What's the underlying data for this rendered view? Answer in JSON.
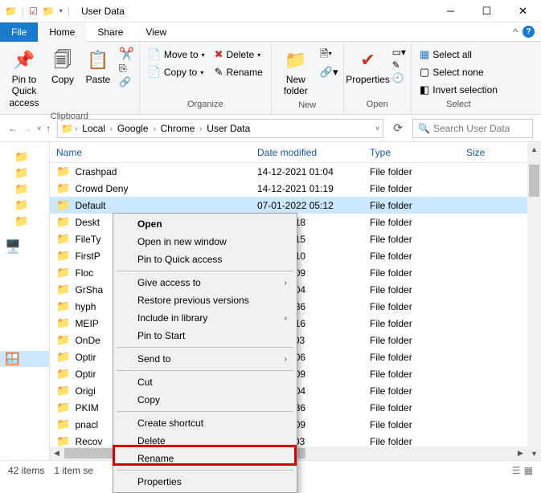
{
  "window": {
    "title": "User Data"
  },
  "tabs": {
    "file": "File",
    "home": "Home",
    "share": "Share",
    "view": "View"
  },
  "ribbon": {
    "clipboard": {
      "label": "Clipboard",
      "pin": "Pin to Quick access",
      "copy": "Copy",
      "paste": "Paste"
    },
    "organize": {
      "label": "Organize",
      "moveto": "Move to",
      "copyto": "Copy to",
      "delete": "Delete",
      "rename": "Rename"
    },
    "new": {
      "label": "New",
      "newfolder": "New folder"
    },
    "open": {
      "label": "Open",
      "properties": "Properties"
    },
    "select": {
      "label": "Select",
      "all": "Select all",
      "none": "Select none",
      "invert": "Invert selection"
    }
  },
  "breadcrumb": [
    "Local",
    "Google",
    "Chrome",
    "User Data"
  ],
  "search": {
    "placeholder": "Search User Data"
  },
  "columns": {
    "name": "Name",
    "date": "Date modified",
    "type": "Type",
    "size": "Size"
  },
  "files": [
    {
      "name": "Crashpad",
      "date": "14-12-2021 01:04",
      "type": "File folder"
    },
    {
      "name": "Crowd Deny",
      "date": "14-12-2021 01:19",
      "type": "File folder"
    },
    {
      "name": "Default",
      "date": "07-01-2022 05:12",
      "type": "File folder",
      "selected": true
    },
    {
      "name": "Deskt",
      "date": "2021 01:18",
      "type": "File folder"
    },
    {
      "name": "FileTy",
      "date": "2021 01:15",
      "type": "File folder"
    },
    {
      "name": "FirstP",
      "date": "2021 01:10",
      "type": "File folder"
    },
    {
      "name": "Floc",
      "date": "2021 01:09",
      "type": "File folder"
    },
    {
      "name": "GrSha",
      "date": "2021 01:04",
      "type": "File folder"
    },
    {
      "name": "hyph",
      "date": "2022 03:36",
      "type": "File folder"
    },
    {
      "name": "MEIP",
      "date": "2021 01:16",
      "type": "File folder"
    },
    {
      "name": "OnDe",
      "date": "2022 11:03",
      "type": "File folder"
    },
    {
      "name": "Optir",
      "date": "2021 01:06",
      "type": "File folder"
    },
    {
      "name": "Optir",
      "date": "2021 01:09",
      "type": "File folder"
    },
    {
      "name": "Origi",
      "date": "2021 01:04",
      "type": "File folder"
    },
    {
      "name": "PKIM",
      "date": "2022 10:36",
      "type": "File folder"
    },
    {
      "name": "pnacl",
      "date": "2021 01:09",
      "type": "File folder"
    },
    {
      "name": "Recov",
      "date": "2022 11:03",
      "type": "File folder"
    }
  ],
  "context": {
    "open": "Open",
    "opennew": "Open in new window",
    "pin": "Pin to Quick access",
    "giveaccess": "Give access to",
    "restore": "Restore previous versions",
    "include": "Include in library",
    "pinstart": "Pin to Start",
    "sendto": "Send to",
    "cut": "Cut",
    "copy": "Copy",
    "createsc": "Create shortcut",
    "delete": "Delete",
    "rename": "Rename",
    "properties": "Properties"
  },
  "status": {
    "items": "42 items",
    "selected": "1 item se"
  }
}
